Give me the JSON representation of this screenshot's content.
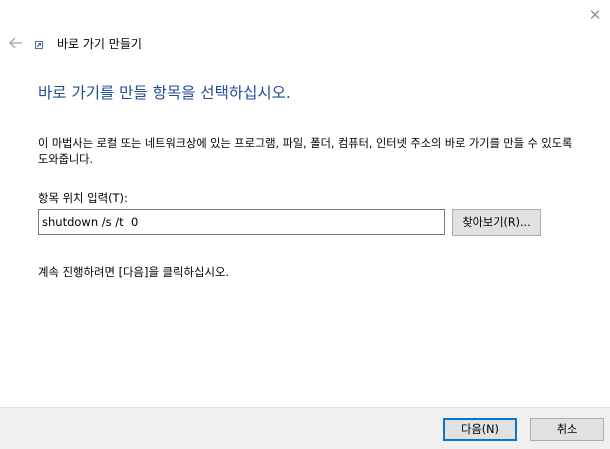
{
  "window": {
    "close_glyph": "✕",
    "back_icon": "back-arrow-icon",
    "wizard_icon": "shortcut-icon"
  },
  "wizard": {
    "title": "바로 가기 만들기"
  },
  "main": {
    "heading": "바로 가기를 만들 항목을 선택하십시오.",
    "description": "이 마법사는 로컬 또는 네트워크상에 있는 프로그램, 파일, 폴더, 컴퓨터, 인터넷 주소의 바로 가기를 만들 수 있도록 도와줍니다.",
    "location_label": "항목 위치 입력(T):",
    "location_value": "shutdown /s /t  0",
    "browse_label": "찾아보기(R)...",
    "continue_text": "계속 진행하려면 [다음]을 클릭하십시오."
  },
  "footer": {
    "next_label": "다음(N)",
    "cancel_label": "취소"
  },
  "colors": {
    "heading": "#1f4e95",
    "default_button_border": "#0078d7",
    "footer_background": "#f0f0f0"
  }
}
